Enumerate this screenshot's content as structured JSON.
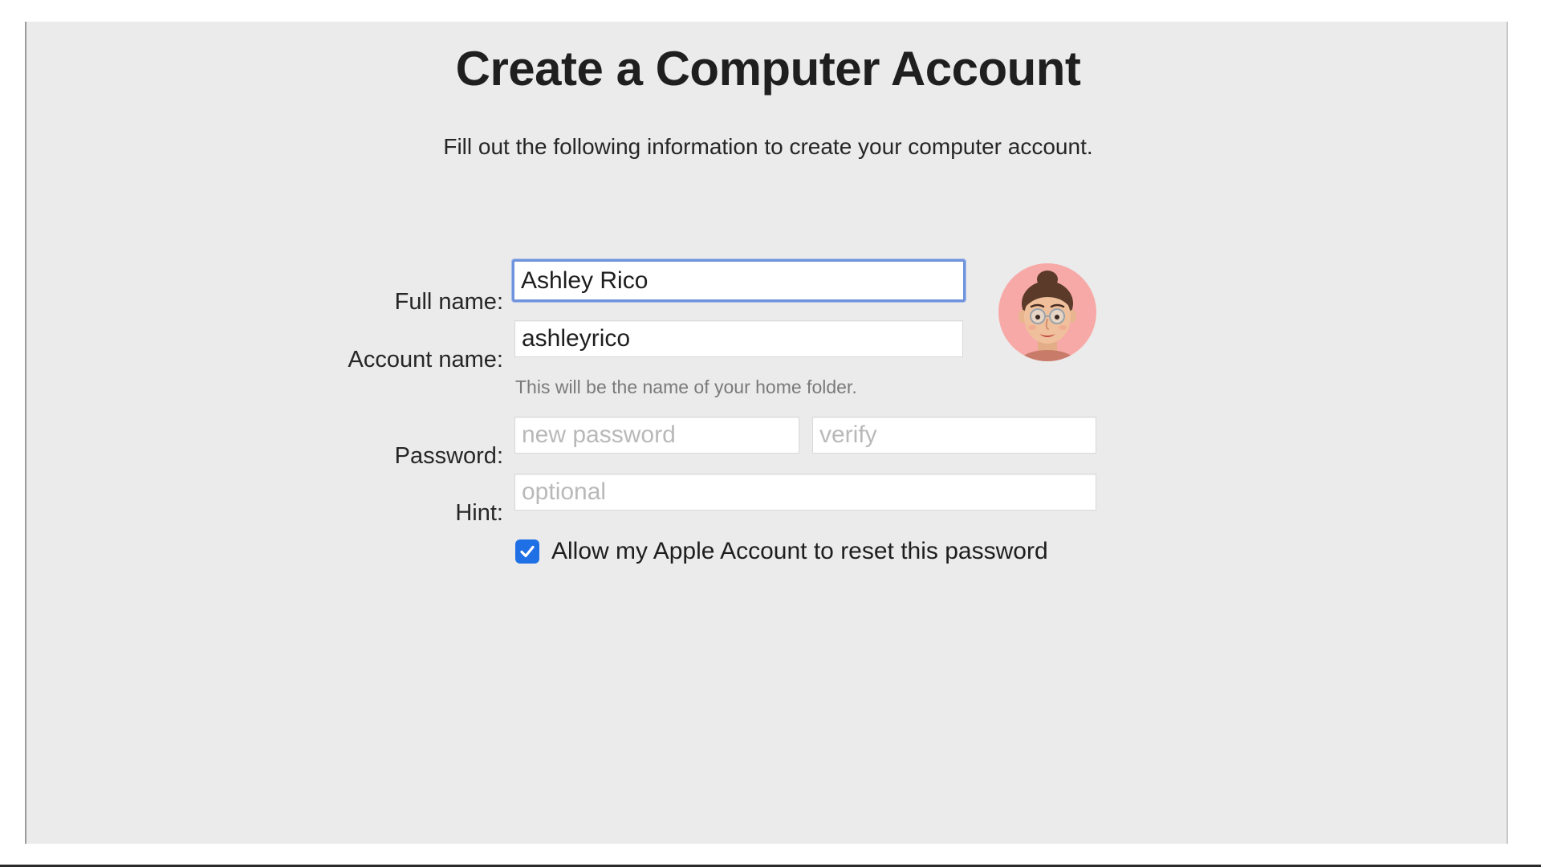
{
  "header": {
    "title": "Create a Computer Account",
    "subtitle": "Fill out the following information to create your computer account."
  },
  "form": {
    "full_name": {
      "label": "Full name:",
      "value": "Ashley Rico"
    },
    "account_name": {
      "label": "Account name:",
      "value": "ashleyrico",
      "help": "This will be the name of your home folder."
    },
    "password": {
      "label": "Password:",
      "placeholder": "new password",
      "verify_placeholder": "verify"
    },
    "hint": {
      "label": "Hint:",
      "placeholder": "optional"
    },
    "reset_option": {
      "label": "Allow my Apple Account to reset this password",
      "checked": true
    }
  },
  "avatar": {
    "icon": "memoji-avatar-icon",
    "background_color": "#f7a9a7"
  },
  "colors": {
    "window_background": "#ebebeb",
    "focus_ring": "#7093dd",
    "checkbox_accent": "#1f6fe5"
  }
}
